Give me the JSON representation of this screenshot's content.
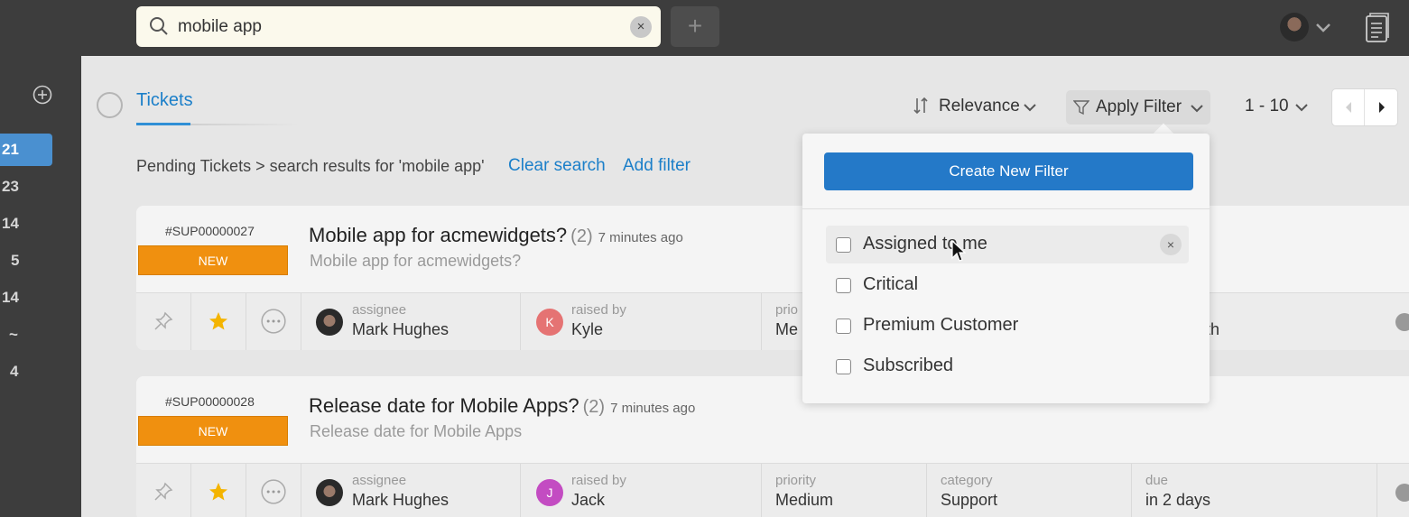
{
  "search": {
    "value": "mobile app",
    "clear": "×"
  },
  "topbar": {
    "add_label": "+"
  },
  "rail": {
    "counts": [
      "21",
      "23",
      "14",
      "5",
      "14",
      "~",
      "4"
    ]
  },
  "tabs": {
    "tickets": "Tickets"
  },
  "toolbar": {
    "sort_label": "Relevance",
    "filter_label": "Apply Filter",
    "range_label": "1 - 10"
  },
  "breadcrumb": {
    "text": "Pending Tickets > search results for 'mobile app'",
    "clear_search": "Clear search",
    "add_filter": "Add filter"
  },
  "tickets": [
    {
      "id": "#SUP00000027",
      "status": "NEW",
      "title": "Mobile app for acmewidgets?",
      "count": "(2)",
      "time": "7 minutes ago",
      "subtitle": "Mobile app for acmewidgets?",
      "assignee_label": "assignee",
      "assignee": "Mark Hughes",
      "raised_label": "raised by",
      "raised_by": "Kyle",
      "raised_initial": "K",
      "priority_label": "prio",
      "priority": "Me",
      "due_partial": "th"
    },
    {
      "id": "#SUP00000028",
      "status": "NEW",
      "title": "Release date for Mobile Apps?",
      "count": "(2)",
      "time": "7 minutes ago",
      "subtitle": "Release date for Mobile Apps",
      "assignee_label": "assignee",
      "assignee": "Mark Hughes",
      "raised_label": "raised by",
      "raised_by": "Jack",
      "raised_initial": "J",
      "priority_label": "priority",
      "priority": "Medium",
      "category_label": "category",
      "category": "Support",
      "due_label": "due",
      "due": "in 2 days"
    }
  ],
  "filter_dropdown": {
    "create_label": "Create New Filter",
    "options": [
      {
        "label": "Assigned to me",
        "remove": "×"
      },
      {
        "label": "Critical"
      },
      {
        "label": "Premium Customer"
      },
      {
        "label": "Subscribed"
      }
    ]
  },
  "colors": {
    "accent": "#2479c8",
    "link": "#1b7fc9",
    "badge_new": "#f0900f",
    "topbar": "#3d3d3d"
  }
}
